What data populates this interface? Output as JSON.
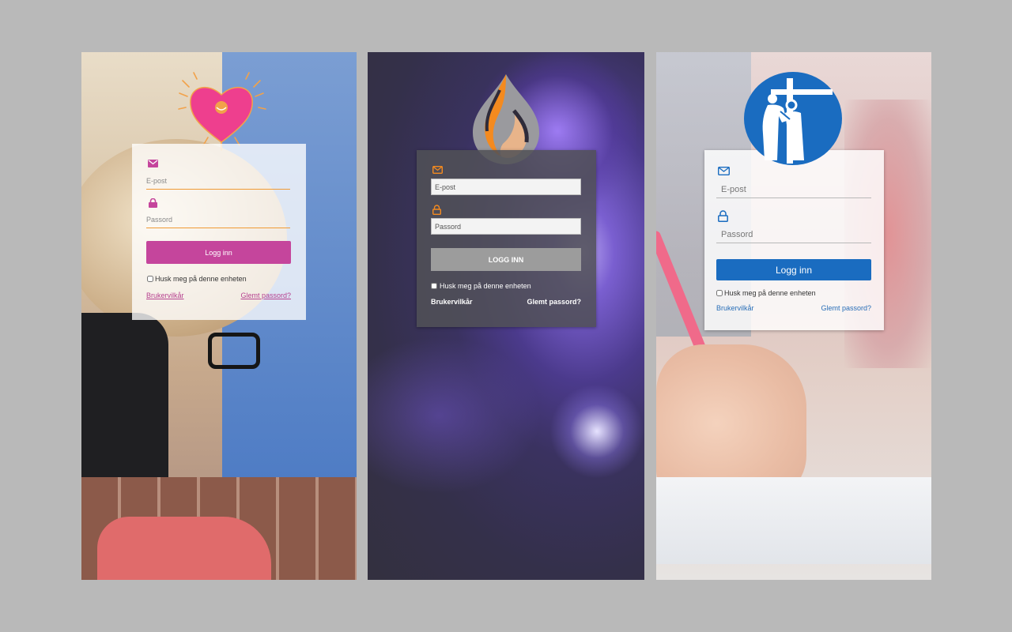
{
  "colors": {
    "background": "#b9b9b9",
    "theme1_accent": "#c5459c",
    "theme1_underline": "#f09a34",
    "theme2_accent": "#f48a1f",
    "theme2_button": "#9c9c9c",
    "theme3_accent": "#1a6cc0"
  },
  "panels": [
    {
      "logo_icon": "heart-logo",
      "email_icon": "envelope-icon",
      "lock_icon": "lock-icon",
      "email_placeholder": "E-post",
      "password_placeholder": "Passord",
      "login_label": "Logg inn",
      "remember_label": "Husk meg på denne enheten",
      "terms_link": "Brukervilkår",
      "forgot_link": "Glemt passord?"
    },
    {
      "logo_icon": "flame-logo",
      "email_icon": "envelope-icon",
      "lock_icon": "lock-icon",
      "email_placeholder": "E-post",
      "password_placeholder": "Passord",
      "login_label": "LOGG INN",
      "remember_label": "Husk meg på denne enheten",
      "terms_link": "Brukervilkår",
      "forgot_link": "Glemt passord?"
    },
    {
      "logo_icon": "cross-figures-logo",
      "email_icon": "envelope-icon",
      "lock_icon": "lock-icon",
      "email_placeholder": "E-post",
      "password_placeholder": "Passord",
      "login_label": "Logg inn",
      "remember_label": "Husk meg på denne enheten",
      "terms_link": "Brukervilkår",
      "forgot_link": "Glemt passord?"
    }
  ]
}
